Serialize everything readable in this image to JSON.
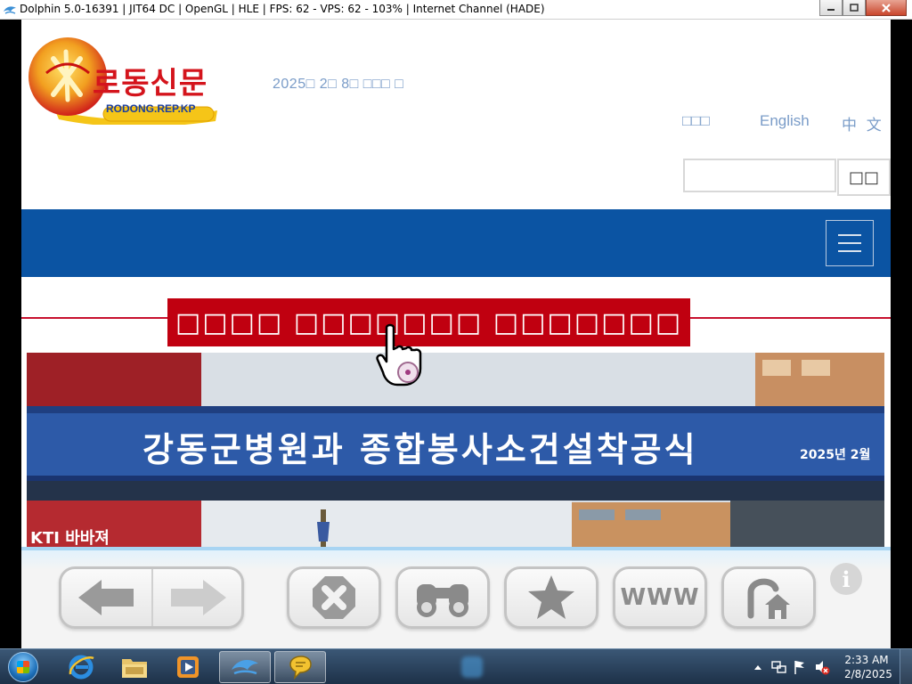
{
  "window": {
    "title": "Dolphin 5.0-16391 | JIT64 DC | OpenGL | HLE | FPS: 62 - VPS: 62 - 103% | Internet Channel (HADE)",
    "icon": "dolphin-icon",
    "buttons": [
      "minimize-icon",
      "maximize-icon",
      "close-icon"
    ]
  },
  "page": {
    "logo": {
      "title_ko": "로동신문",
      "subtitle": "RODONG.REP.KP"
    },
    "date": "2025□ 2□ 8□ □□□  □",
    "languages": {
      "korean": "□□□",
      "english": "English",
      "chinese": "中 文"
    },
    "search": {
      "value": "",
      "button_label": "□□"
    },
    "menu_icon": "hamburger-menu-icon",
    "headline_banner": "□□□□ □□□□□□□ □□□□□□□",
    "photo": {
      "caption": "강동군병원과 종합봉사소건설착공식",
      "date": "2025년 2월",
      "sign_text": "KTI 바바져"
    }
  },
  "toolbar": {
    "back_icon": "back-arrow-icon",
    "forward_icon": "forward-arrow-icon",
    "stop_icon": "stop-icon",
    "search_icon": "binoculars-icon",
    "favorites_icon": "star-icon",
    "www_label": "WWW",
    "home_icon": "home-icon",
    "info_label": "i"
  },
  "taskbar": {
    "clock_time": "2:33 AM",
    "clock_date": "2/8/2025",
    "apps": [
      "internet-explorer-icon",
      "file-explorer-icon",
      "media-player-icon",
      "dolphin-icon",
      "chat-bubble-icon"
    ]
  },
  "colors": {
    "nav_blue": "#0b54a3",
    "headline_red": "#c00010",
    "link_blue": "#7a9cc8",
    "taskbar": "#2a4560"
  }
}
